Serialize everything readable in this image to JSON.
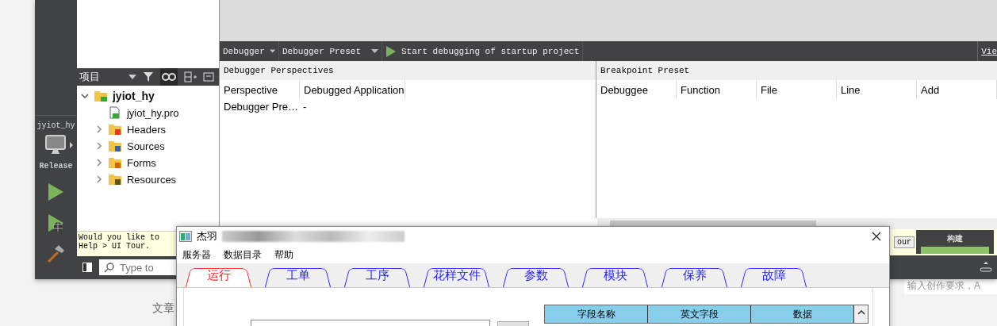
{
  "ide": {
    "mode_bar": {
      "project": "jyiot_hy",
      "build_config": "Release"
    },
    "project_panel": {
      "title": "项目",
      "tree": [
        {
          "label": "jyiot_hy",
          "kind": "project",
          "expanded": true,
          "children": [
            {
              "label": "jyiot_hy.pro",
              "kind": "file"
            },
            {
              "label": "Headers",
              "kind": "headers",
              "expanded": false
            },
            {
              "label": "Sources",
              "kind": "sources",
              "expanded": false
            },
            {
              "label": "Forms",
              "kind": "forms",
              "expanded": false
            },
            {
              "label": "Resources",
              "kind": "resources",
              "expanded": false
            }
          ]
        }
      ]
    },
    "tour_hint": [
      "Would you like to",
      "Help > UI Tour."
    ],
    "locator": {
      "placeholder": "Type to"
    },
    "debug_toolbar": {
      "perspective": "Debugger",
      "preset": "Debugger Preset",
      "start": "Start debugging of startup project",
      "view": "Vie"
    },
    "perspectives": {
      "title": "Debugger Perspectives",
      "columns": [
        "Perspective",
        "Debugged Application"
      ],
      "rows": [
        [
          "Debugger Pre…",
          "-"
        ]
      ]
    },
    "breakpoints": {
      "title": "Breakpoint Preset",
      "columns": [
        "Debuggee",
        "Function",
        "File",
        "Line",
        "Add"
      ]
    },
    "tour_button": "our",
    "build_progress": {
      "label": "构建",
      "level": 1
    }
  },
  "dialog": {
    "title": "杰羽",
    "menu": [
      "服务器",
      "数据目录",
      "帮助"
    ],
    "tabs": [
      {
        "label": "运行",
        "selected": true
      },
      {
        "label": "工单",
        "selected": false
      },
      {
        "label": "工序",
        "selected": false
      },
      {
        "label": "花样文件",
        "selected": false
      },
      {
        "label": "参数",
        "selected": false
      },
      {
        "label": "模块",
        "selected": false
      },
      {
        "label": "保养",
        "selected": false
      },
      {
        "label": "故障",
        "selected": false
      }
    ],
    "table": {
      "columns": [
        "字段名称",
        "英文字段",
        "数据"
      ]
    }
  },
  "background_page": {
    "texts": [
      "文章",
      "输入创作要求，A"
    ]
  }
}
